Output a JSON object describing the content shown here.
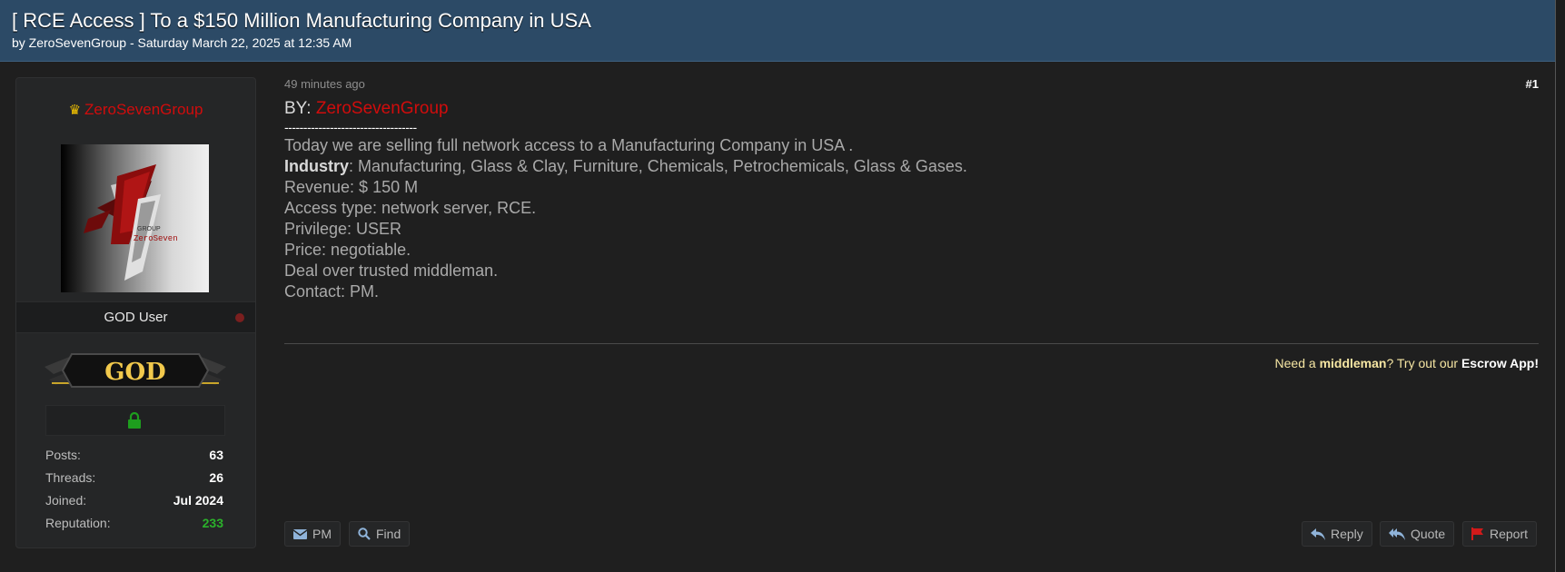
{
  "header": {
    "title": "[ RCE Access ] To a $150 Million Manufacturing Company in USA",
    "byline": "by ZeroSevenGroup - Saturday March 22, 2025 at 12:35 AM"
  },
  "user": {
    "username": "ZeroSevenGroup",
    "rank": "GOD User",
    "badge_text": "GOD",
    "stats": [
      {
        "label": "Posts:",
        "value": "63"
      },
      {
        "label": "Threads:",
        "value": "26"
      },
      {
        "label": "Joined:",
        "value": "Jul 2024"
      },
      {
        "label": "Reputation:",
        "value": "233"
      }
    ],
    "avatar_text_1": "GROUP",
    "avatar_text_2": "ZeroSeven",
    "colors": {
      "username": "#d10c0c",
      "reputation": "#2bb02b",
      "crown": "#f2c200",
      "lock": "#1e9e1e"
    }
  },
  "post": {
    "time": "49 minutes ago",
    "number": "#1",
    "by_label": "BY:",
    "by_name": "ZeroSevenGroup",
    "separator": "-----------------------------------",
    "intro": "Today we are selling full network access to a Manufacturing Company in USA .",
    "industry_label": "Industry",
    "industry_value": ": Manufacturing, Glass & Clay, Furniture, Chemicals, Petrochemicals, Glass & Gases.",
    "revenue": "Revenue: $ 150 M",
    "access": "Access type: network server, RCE.",
    "privilege": "Privilege: USER",
    "price": "Price: negotiable.",
    "deal": "Deal over trusted middleman.",
    "contact": "Contact: PM."
  },
  "signature": {
    "pre": "Need a ",
    "middleman": "middleman",
    "mid": "? Try out our ",
    "app": "Escrow App!"
  },
  "actions": {
    "pm": "PM",
    "find": "Find",
    "reply": "Reply",
    "quote": "Quote",
    "report": "Report"
  }
}
